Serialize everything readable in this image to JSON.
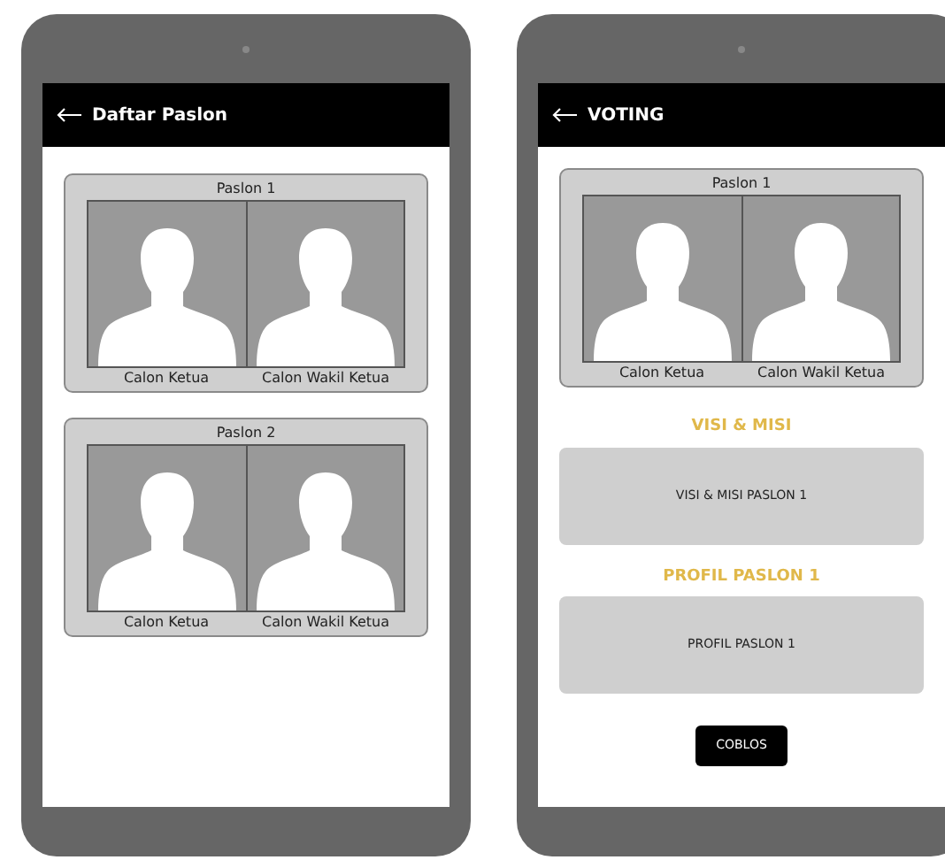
{
  "screens": [
    {
      "title": "Daftar Paslon",
      "candidates": [
        {
          "label": "Paslon 1",
          "photos": [
            {
              "caption": "Calon Ketua"
            },
            {
              "caption": "Calon Wakil Ketua"
            }
          ]
        },
        {
          "label": "Paslon 2",
          "photos": [
            {
              "caption": "Calon Ketua"
            },
            {
              "caption": "Calon Wakil Ketua"
            }
          ]
        }
      ]
    },
    {
      "title": "VOTING",
      "candidates": [
        {
          "label": "Paslon 1",
          "photos": [
            {
              "caption": "Calon Ketua"
            },
            {
              "caption": "Calon Wakil Ketua"
            }
          ]
        }
      ],
      "sections": [
        {
          "heading": "VISI & MISI",
          "body": "VISI & MISI PASLON 1"
        },
        {
          "heading": "PROFIL PASLON 1",
          "body": "PROFIL PASLON 1"
        }
      ],
      "button": "COBLOS"
    }
  ]
}
